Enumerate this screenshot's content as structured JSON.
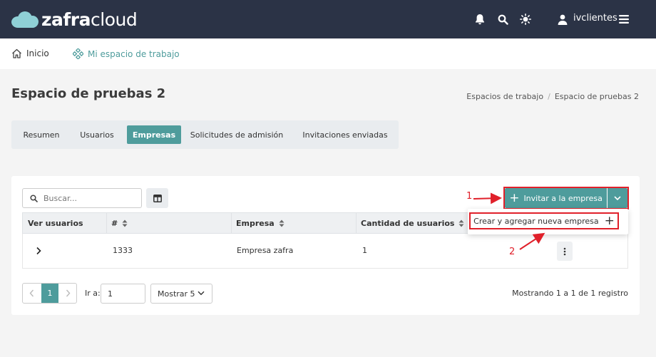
{
  "header": {
    "logo": {
      "bold": "zafra",
      "light": "cloud"
    },
    "icons": [
      "bell-icon",
      "search-icon",
      "sun-icon",
      "user-icon",
      "hamburger-menu-icon"
    ],
    "user_name": "ivclientes"
  },
  "nav": {
    "home_label": "Inicio",
    "workspace_label": "Mi espacio de trabajo"
  },
  "page": {
    "title": "Espacio de pruebas 2",
    "breadcrumb": [
      "Espacios de trabajo",
      "/",
      "Espacio de pruebas 2"
    ]
  },
  "tabs": [
    {
      "label": "Resumen",
      "active": false
    },
    {
      "label": "Usuarios",
      "active": false
    },
    {
      "label": "Empresas",
      "active": true
    },
    {
      "label": "Solicitudes de admisión",
      "active": false
    },
    {
      "label": "Invitaciones enviadas",
      "active": false
    }
  ],
  "toolbar": {
    "search_placeholder": "Buscar...",
    "invite_label": "Invitar a la empresa",
    "dropdown_item": "Crear y agregar nueva empresa"
  },
  "table": {
    "columns": [
      "Ver usuarios",
      "#",
      "Empresa",
      "Cantidad de usuarios"
    ],
    "rows": [
      {
        "id": "1333",
        "empresa": "Empresa zafra",
        "cantidad": "1"
      }
    ]
  },
  "pagination": {
    "current_page": "1",
    "goto_label": "Ir a:",
    "goto_value": "1",
    "page_size_label": "Mostrar 5",
    "records_text": "Mostrando 1 a 1 de 1 registro"
  },
  "annotations": {
    "one": "1",
    "two": "2"
  },
  "colors": {
    "topbar": "#2b3346",
    "accent": "#4e9c9c",
    "annotation_red": "#e0202a"
  }
}
